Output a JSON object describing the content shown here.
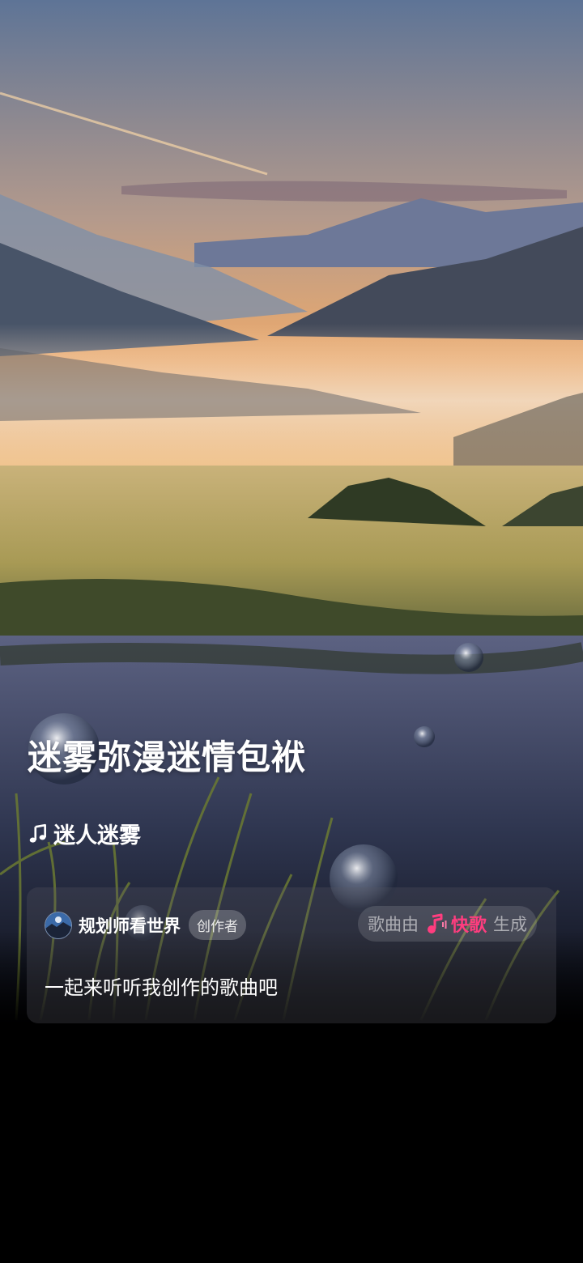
{
  "song": {
    "title": "迷雾弥漫迷情包袱",
    "tag": "迷人迷雾"
  },
  "creator": {
    "name": "规划师看世界",
    "badge": "创作者"
  },
  "generator": {
    "prefix": "歌曲由",
    "app_name": "快歌",
    "suffix": "生成"
  },
  "description": "一起来听听我创作的歌曲吧",
  "icons": {
    "tag": "music-note-icon",
    "app": "kuaige-app-icon"
  },
  "colors": {
    "accent": "#ff3d7f",
    "background": "#000000"
  }
}
